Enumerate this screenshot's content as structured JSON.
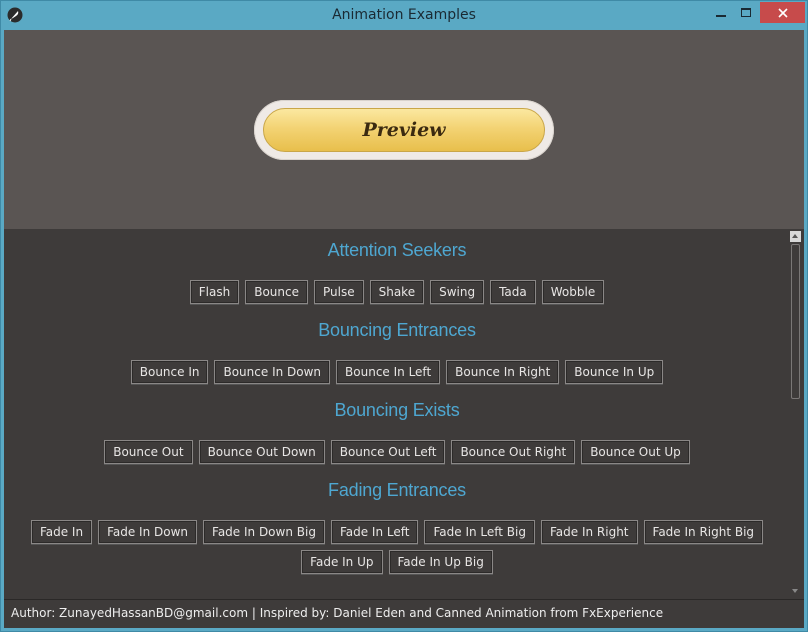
{
  "window": {
    "title": "Animation Examples",
    "icon": "feather-icon"
  },
  "preview": {
    "label": "Preview"
  },
  "sections": [
    {
      "title": "Attention Seekers",
      "buttons": [
        "Flash",
        "Bounce",
        "Pulse",
        "Shake",
        "Swing",
        "Tada",
        "Wobble"
      ]
    },
    {
      "title": "Bouncing Entrances",
      "buttons": [
        "Bounce In",
        "Bounce In Down",
        "Bounce In Left",
        "Bounce In Right",
        "Bounce In Up"
      ]
    },
    {
      "title": "Bouncing Exists",
      "buttons": [
        "Bounce Out",
        "Bounce Out Down",
        "Bounce Out Left",
        "Bounce Out Right",
        "Bounce Out Up"
      ]
    },
    {
      "title": "Fading Entrances",
      "buttons": [
        "Fade In",
        "Fade In Down",
        "Fade In Down Big",
        "Fade In Left",
        "Fade In Left Big",
        "Fade In Right",
        "Fade In Right Big"
      ],
      "buttons_row2": [
        "Fade In Up",
        "Fade In Up Big"
      ]
    }
  ],
  "footer": {
    "text": "Author: ZunayedHassanBD@gmail.com | Inspired by: Daniel Eden and Canned Animation from FxExperience"
  },
  "colors": {
    "titlebar": "#5aa9c4",
    "close_button": "#c74b4b",
    "preview_bg": "#5a5553",
    "list_bg": "#3e3b3a",
    "section_title": "#4ea7d1",
    "preview_button_gold": "#f3d374"
  }
}
